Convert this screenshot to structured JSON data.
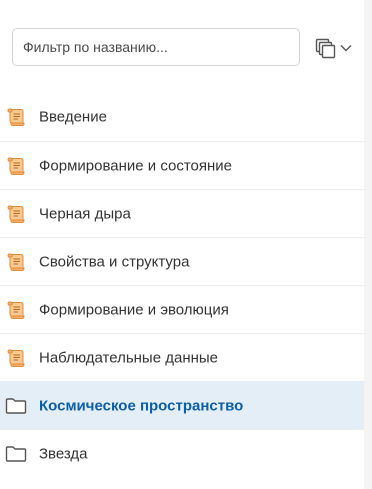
{
  "filter": {
    "placeholder": "Фильтр по названию..."
  },
  "toolbar": {
    "view_icon": "stacked-pages-icon",
    "dropdown_icon": "chevron-down-icon"
  },
  "items": [
    {
      "label": "Введение",
      "icon": "scroll-icon"
    },
    {
      "label": "Формирование и состояние",
      "icon": "scroll-icon"
    },
    {
      "label": "Черная дыра",
      "icon": "scroll-icon"
    },
    {
      "label": "Свойства и структура",
      "icon": "scroll-icon"
    },
    {
      "label": "Формирование и эволюция",
      "icon": "scroll-icon"
    },
    {
      "label": "Наблюдательные данные",
      "icon": "scroll-icon"
    },
    {
      "label": "Космическое пространство",
      "icon": "folder-icon",
      "selected": true
    },
    {
      "label": "Звезда",
      "icon": "folder-icon"
    }
  ],
  "colors": {
    "selected_bg": "#e4eef7",
    "selected_text": "#0b5ea8",
    "scroll_icon": "#f0a860"
  }
}
